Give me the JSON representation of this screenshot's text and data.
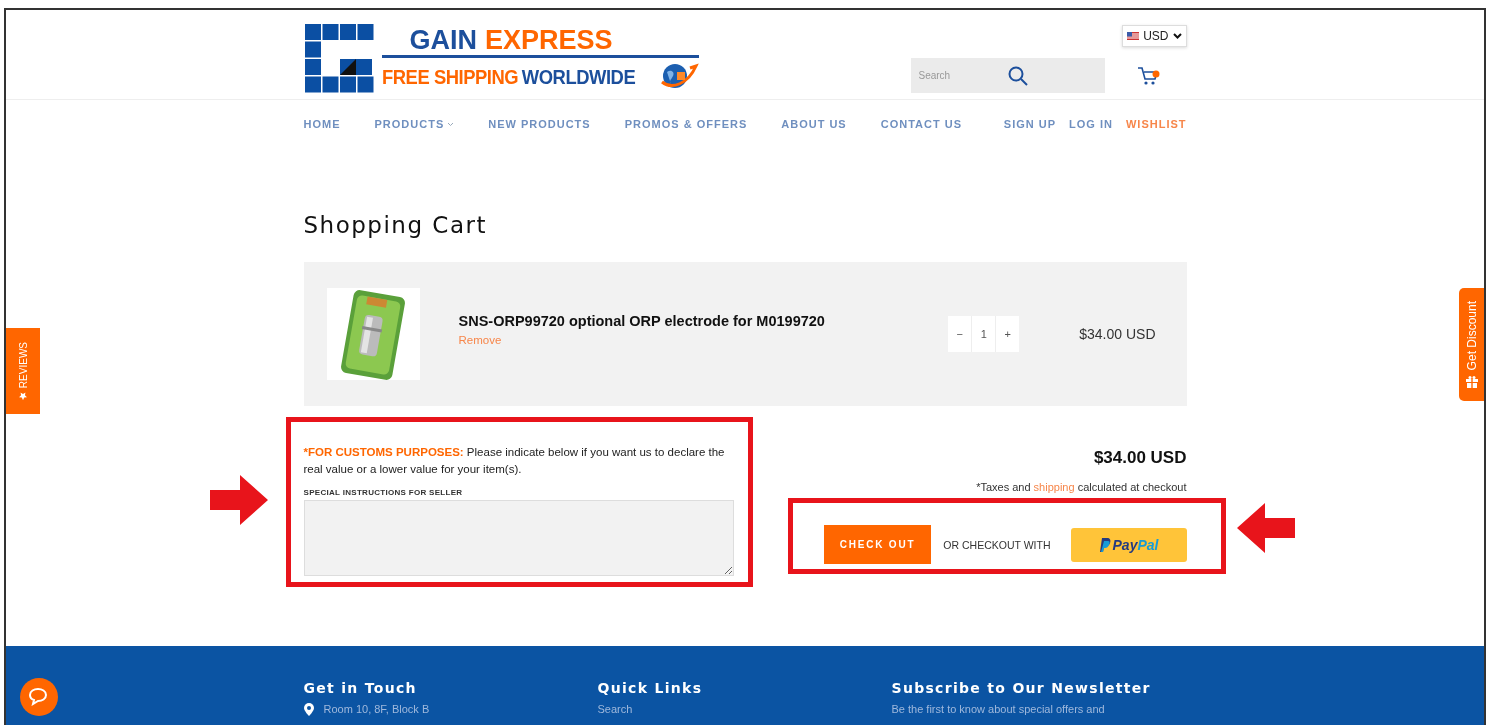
{
  "currency": {
    "label": "USD"
  },
  "logo": {
    "title": [
      {
        "text": "GAIN",
        "color": "#1c4f9c"
      },
      {
        "text": "EXPRESS",
        "color": "#ff6600"
      }
    ],
    "tagline": [
      {
        "text": "FREE SHIPPING",
        "color": "#ff6600"
      },
      {
        "text": "WORLDWIDE",
        "color": "#1c4f9c"
      }
    ]
  },
  "search": {
    "placeholder": "Search"
  },
  "nav": [
    {
      "label": "HOME",
      "dropdown": false
    },
    {
      "label": "PRODUCTS",
      "dropdown": true
    },
    {
      "label": "NEW PRODUCTS",
      "dropdown": false
    },
    {
      "label": "PROMOS & OFFERS",
      "dropdown": false
    },
    {
      "label": "ABOUT US",
      "dropdown": false
    },
    {
      "label": "CONTACT US",
      "dropdown": false
    }
  ],
  "account_links": [
    {
      "label": "SIGN UP",
      "highlighted": false
    },
    {
      "label": "LOG IN",
      "highlighted": false
    },
    {
      "label": "WISHLIST",
      "highlighted": true
    }
  ],
  "page_title": "Shopping Cart",
  "cart": {
    "items": [
      {
        "name": "SNS-ORP99720 optional ORP electrode for M0199720",
        "remove": "Remove",
        "decrease": "−",
        "quantity": "1",
        "increase": "+",
        "price": "$34.00 USD"
      }
    ]
  },
  "note": {
    "emphasis": "*FOR CUSTOMS PURPOSES:",
    "text": "Please indicate below if you want us to declare the real value or a lower value for your item(s)."
  },
  "instructions": {
    "label": "SPECIAL INSTRUCTIONS FOR SELLER"
  },
  "subtotal": "$34.00 USD",
  "tax_note": {
    "before": "*Taxes and",
    "link": "shipping",
    "after": "calculated at checkout"
  },
  "checkout": {
    "button": "CHECK OUT",
    "alt_label": "OR CHECKOUT WITH",
    "paypal": [
      {
        "text": "Pay",
        "color": "#253b80"
      },
      {
        "text": "Pal",
        "color": "#179bd7"
      }
    ]
  },
  "side_tabs": {
    "reviews": "REVIEWS",
    "discount": "Get Discount"
  },
  "footer": [
    {
      "heading": "Get in Touch",
      "line": "Room 10, 8F, Block B"
    },
    {
      "heading": "Quick Links",
      "line": "Search"
    },
    {
      "heading": "Subscribe to Our Newsletter",
      "line": "Be the first to know about special offers and"
    }
  ]
}
